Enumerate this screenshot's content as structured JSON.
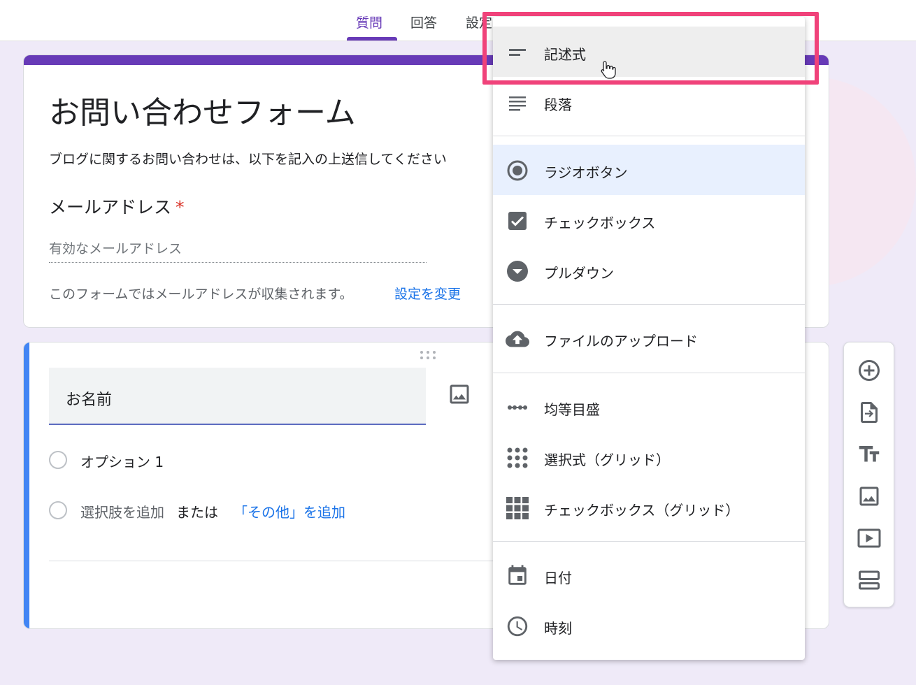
{
  "tabs": [
    {
      "label": "質問",
      "active": true
    },
    {
      "label": "回答",
      "active": false
    },
    {
      "label": "設定",
      "active": false
    }
  ],
  "form": {
    "title": "お問い合わせフォーム",
    "description": "ブログに関するお問い合わせは、以下を記入の上送信してください",
    "email_label": "メールアドレス",
    "required_mark": "*",
    "email_placeholder": "有効なメールアドレス",
    "collect_note": "このフォームではメールアドレスが収集されます。",
    "change_settings_link": "設定を変更"
  },
  "question": {
    "title": "お名前",
    "option_1": "オプション 1",
    "add_option": "選択肢を追加",
    "or": "または",
    "add_other": "「その他」を追加"
  },
  "side_toolbar": {
    "buttons": [
      "add-question-icon",
      "import-questions-icon",
      "add-title-icon",
      "add-image-icon",
      "add-video-icon",
      "add-section-icon"
    ]
  },
  "type_menu": {
    "hovered": "記述式",
    "selected": "ラジオボタン",
    "items": [
      {
        "label": "記述式",
        "icon": "short-answer-icon"
      },
      {
        "label": "段落",
        "icon": "paragraph-icon"
      },
      {
        "label": "ラジオボタン",
        "icon": "radio-button-icon"
      },
      {
        "label": "チェックボックス",
        "icon": "checkbox-icon"
      },
      {
        "label": "プルダウン",
        "icon": "dropdown-icon"
      },
      {
        "label": "ファイルのアップロード",
        "icon": "cloud-upload-icon"
      },
      {
        "label": "均等目盛",
        "icon": "linear-scale-icon"
      },
      {
        "label": "選択式（グリッド）",
        "icon": "multiple-choice-grid-icon"
      },
      {
        "label": "チェックボックス（グリッド）",
        "icon": "checkbox-grid-icon"
      },
      {
        "label": "日付",
        "icon": "calendar-icon"
      },
      {
        "label": "時刻",
        "icon": "clock-icon"
      }
    ]
  },
  "colors": {
    "accent_purple": "#673ab7",
    "question_accent_blue": "#4285f4",
    "link_blue": "#1a73e8",
    "highlight_pink": "#f0427a",
    "background_lavender": "#efeaf8"
  }
}
